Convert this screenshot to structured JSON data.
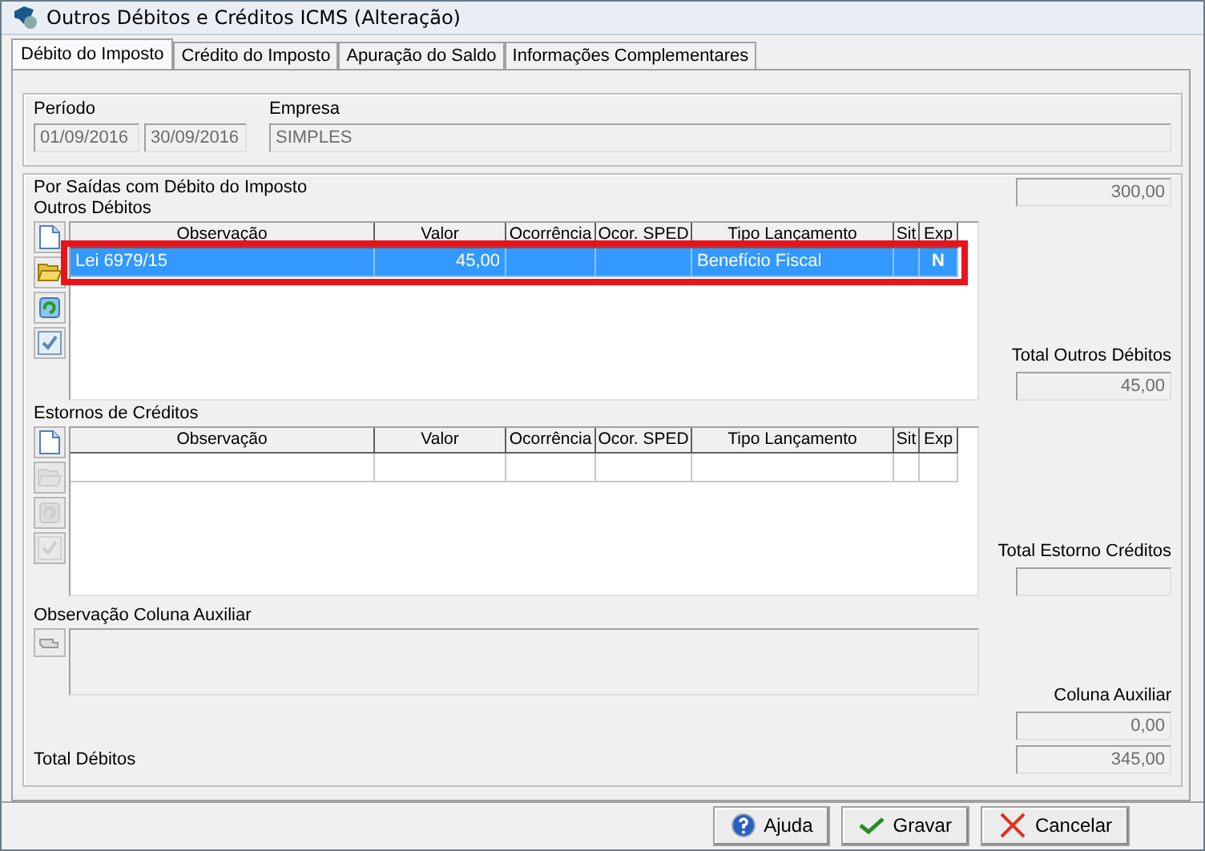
{
  "window": {
    "title": "Outros Débitos e Créditos ICMS (Alteração)"
  },
  "tabs": [
    {
      "label": "Débito do Imposto",
      "selected": true
    },
    {
      "label": "Crédito do Imposto",
      "selected": false
    },
    {
      "label": "Apuração do Saldo",
      "selected": false
    },
    {
      "label": "Informações Complementares",
      "selected": false
    }
  ],
  "periodo": {
    "label": "Período",
    "start": "01/09/2016",
    "end": "30/09/2016"
  },
  "empresa": {
    "label": "Empresa",
    "value": "SIMPLES"
  },
  "section_title": "Por Saídas com Débito do Imposto",
  "section_total": "300,00",
  "outros_debitos": {
    "label": "Outros Débitos",
    "toolbar": [
      {
        "kind": "new",
        "disabled": false
      },
      {
        "kind": "open",
        "disabled": false
      },
      {
        "kind": "refresh",
        "disabled": false
      },
      {
        "kind": "check",
        "disabled": false
      }
    ],
    "columns": [
      "Observação",
      "Valor",
      "Ocorrência",
      "Ocor. SPED",
      "Tipo Lançamento",
      "Sit",
      "Exp"
    ],
    "rows": [
      {
        "cells": [
          "Lei 6979/15",
          "45,00",
          "",
          "",
          "Benefício Fiscal",
          "",
          "N"
        ],
        "selected": true
      }
    ],
    "highlighted": true,
    "total_label": "Total Outros Débitos",
    "total": "45,00"
  },
  "estornos": {
    "label": "Estornos de Créditos",
    "toolbar": [
      {
        "kind": "new",
        "disabled": false
      },
      {
        "kind": "open",
        "disabled": true
      },
      {
        "kind": "refresh",
        "disabled": true
      },
      {
        "kind": "check",
        "disabled": true
      }
    ],
    "columns": [
      "Observação",
      "Valor",
      "Ocorrência",
      "Ocor. SPED",
      "Tipo Lançamento",
      "Sit",
      "Exp"
    ],
    "rows": [
      {
        "cells": [
          "",
          "",
          "",
          "",
          "",
          "",
          ""
        ],
        "selected": false
      }
    ],
    "total_label": "Total Estorno Créditos"
  },
  "auxiliar": {
    "label": "Observação Coluna Auxiliar",
    "total_label": "Coluna Auxiliar",
    "total": "0,00"
  },
  "total_debitos": {
    "label": "Total Débitos",
    "value": "345,00"
  },
  "buttons": [
    {
      "kind": "help",
      "label": "Ajuda"
    },
    {
      "kind": "save",
      "label": "Gravar"
    },
    {
      "kind": "cancel",
      "label": "Cancelar"
    }
  ]
}
